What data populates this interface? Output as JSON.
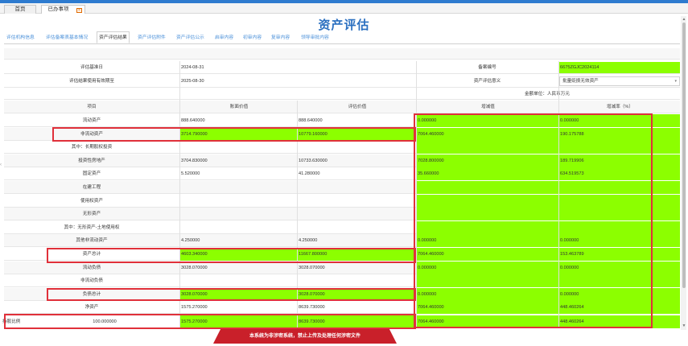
{
  "window_tabs": [
    {
      "label": "首页"
    },
    {
      "label": "已办事项"
    }
  ],
  "page_title": "资产评估",
  "subnav_tabs": [
    {
      "label": "评估机构信息"
    },
    {
      "label": "评估备案表基本情况"
    },
    {
      "label": "资产评估结果"
    },
    {
      "label": "资产评估附件"
    },
    {
      "label": "资产评估公示"
    },
    {
      "label": "启审内容"
    },
    {
      "label": "初审内容"
    },
    {
      "label": "复审内容"
    },
    {
      "label": "领导审批内容"
    }
  ],
  "meta": {
    "base_date_label": "评估基准日",
    "base_date_value": "2024-08-31",
    "valid_until_label": "评估结果使用有效期至",
    "valid_until_value": "2025-08-30",
    "record_no_label": "备案编号",
    "record_no_value": "6675ZGJC2024114",
    "purpose_label": "资产评估意义",
    "purpose_value": "批量贬损无效资产",
    "unit_label": "金额单位：人民币万元"
  },
  "columns": {
    "item": "项目",
    "book": "账面价值",
    "eval": "评估价值",
    "diff": "增减值",
    "rate": "增减率（%）"
  },
  "rows": [
    {
      "label": "流动资产",
      "book": "888.640000",
      "eval": "888.640000",
      "diff": "0.000000",
      "rate": "0.000000"
    },
    {
      "label": "非流动资产",
      "book": "3714.790000",
      "eval": "10779.160000",
      "diff": "7064.460000",
      "rate": "190.175788"
    },
    {
      "label": "其中：长期股权投资",
      "book": "",
      "eval": "",
      "diff": "",
      "rate": ""
    },
    {
      "label": "投资性房地产",
      "book": "3704.830000",
      "eval": "10733.630000",
      "diff": "7028.800000",
      "rate": "189.719906"
    },
    {
      "label": "固定资产",
      "book": "5.520000",
      "eval": "41.280000",
      "diff": "35.660000",
      "rate": "634.519573"
    },
    {
      "label": "在建工程",
      "book": "",
      "eval": "",
      "diff": "",
      "rate": ""
    },
    {
      "label": "使用权资产",
      "book": "",
      "eval": "",
      "diff": "",
      "rate": ""
    },
    {
      "label": "无形资产",
      "book": "",
      "eval": "",
      "diff": "",
      "rate": ""
    },
    {
      "label": "其中：无形资产-土地使用权",
      "book": "",
      "eval": "",
      "diff": "",
      "rate": ""
    },
    {
      "label": "其他非流动资产",
      "book": "4.250000",
      "eval": "4.250000",
      "diff": "0.000000",
      "rate": "0.000000"
    },
    {
      "label": "资产总计",
      "book": "4603.340000",
      "eval": "11667.800000",
      "diff": "7064.460000",
      "rate": "153.463789"
    },
    {
      "label": "流动负债",
      "book": "3028.070000",
      "eval": "3028.070000",
      "diff": "0.000000",
      "rate": "0.000000"
    },
    {
      "label": "非流动负债",
      "book": "",
      "eval": "",
      "diff": "",
      "rate": ""
    },
    {
      "label": "负债总计",
      "book": "3028.070000",
      "eval": "3028.070000",
      "diff": "0.000000",
      "rate": "0.000000"
    },
    {
      "label": "净资产",
      "book": "1575.270000",
      "eval": "8639.730000",
      "diff": "7064.460000",
      "rate": "448.460264"
    }
  ],
  "last_row": {
    "label": "持股比例",
    "pct": "100.000000",
    "book": "1575.270000",
    "eval": "8639.730000",
    "diff": "7064.460000",
    "rate": "448.460264"
  },
  "banner_text": "本系统为非涉密系统，禁止上传及处理任何涉密文件",
  "colors": {
    "highlight_green": "#8cff00",
    "annotation_red": "#e0303a",
    "title_blue": "#2a6fc0",
    "banner_red": "#c9202a"
  }
}
